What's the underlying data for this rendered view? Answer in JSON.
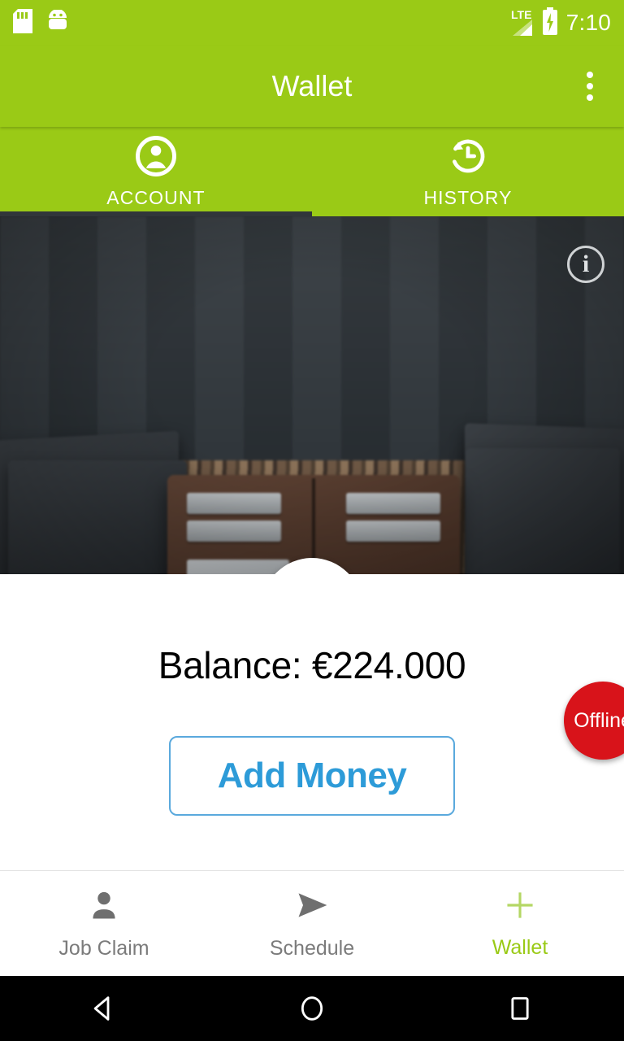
{
  "status_bar": {
    "icons": [
      "sd-card-icon",
      "android-bugdroid-icon"
    ],
    "network_label": "LTE",
    "battery": "charging",
    "time": "7:10"
  },
  "toolbar": {
    "title": "Wallet",
    "overflow_label": "More options",
    "background_color": "#9ACA16"
  },
  "tabs": {
    "items": [
      {
        "label": "ACCOUNT",
        "icon": "account-circle-icon",
        "active": true
      },
      {
        "label": "HISTORY",
        "icon": "history-clock-icon",
        "active": false
      }
    ],
    "indicator_color": "#31363a"
  },
  "banner": {
    "image_alt": "leather wallets on wooden table",
    "avatar_icon": "wallet-avatar-icon",
    "info_icon": "info-icon",
    "info_glyph": "i"
  },
  "account": {
    "balance_label": "Balance: €224.000",
    "add_money_label": "Add Money",
    "add_money_color": "#2d9bd8",
    "status_fab_label": "Offline",
    "status_fab_color": "#d8131a"
  },
  "bottom_nav": {
    "items": [
      {
        "label": "Job Claim",
        "icon": "person-icon",
        "active": false
      },
      {
        "label": "Schedule",
        "icon": "send-arrow-icon",
        "active": false
      },
      {
        "label": "Wallet",
        "icon": "plus-icon",
        "active": true
      }
    ],
    "active_color": "#9ACA16",
    "inactive_color": "#7b7b7b"
  },
  "system_nav": {
    "back_label": "Back",
    "home_label": "Home",
    "recents_label": "Recents"
  }
}
